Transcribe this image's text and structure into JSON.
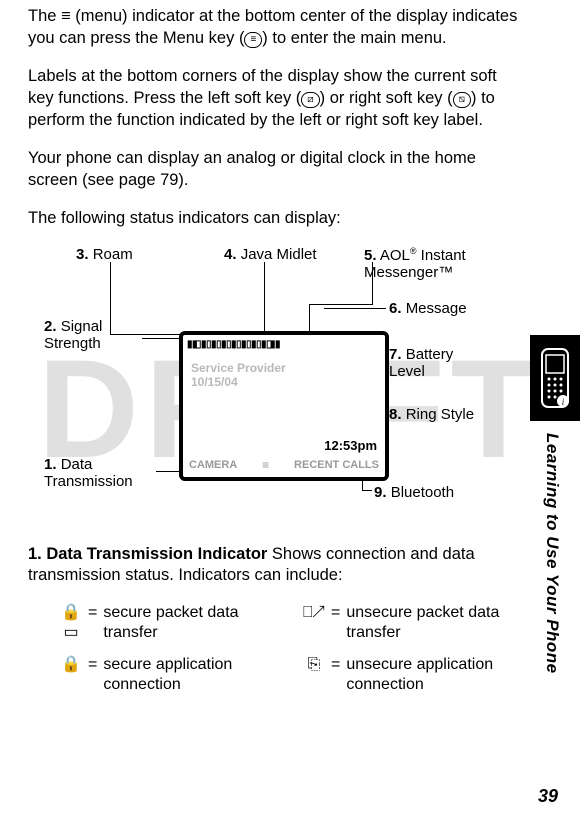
{
  "paragraphs": {
    "p1_a": "The ",
    "p1_menuicon": "≡",
    "p1_b": " (menu) indicator at the bottom center of the display indicates you can press the Menu key (",
    "p1_keyicon": "≡",
    "p1_c": ") to enter the main menu.",
    "p2_a": "Labels at the bottom corners of the display show the current soft key functions. Press the left soft key (",
    "p2_left": "⧄",
    "p2_b": ") or right soft key (",
    "p2_right": "⧅",
    "p2_c": ") to perform the function indicated by the left or right soft key label.",
    "p3": "Your phone can display an analog or digital clock in the home screen (see page 79).",
    "p4": "The following status indicators can display:"
  },
  "callouts": {
    "c1_num": "1.",
    "c1_label": "Data Transmission",
    "c2_num": "2.",
    "c2_label": "Signal Strength",
    "c3_num": "3.",
    "c3_label": "Roam",
    "c4_num": "4.",
    "c4_label": "Java Midlet",
    "c5_num": "5.",
    "c5_label_a": "AOL",
    "c5_reg": "®",
    "c5_label_b": " Instant Messenger™",
    "c6_num": "6.",
    "c6_label": "Message",
    "c7_num": "7.",
    "c7_label": "Battery Level",
    "c8_num": "8.",
    "c8_label": "Ring Style",
    "c9_num": "9.",
    "c9_label": "Bluetooth"
  },
  "screen": {
    "statusbar": "▮◧▮▯▮▯▮▯▮▯▮▯▮▯▮◨▮",
    "provider": "Service Provider",
    "date": "10/15/04",
    "clock": "12:53pm",
    "soft_left": "CAMERA",
    "soft_mid": "≡",
    "soft_right": "RECENT CALLS"
  },
  "section": {
    "heading": "1. Data Transmission Indicator",
    "body": " Shows connection and data transmission status. Indicators can include:"
  },
  "defs": {
    "a_icon": "🔒▭",
    "a_text": "secure packet data transfer",
    "b_icon": "⎕↗",
    "b_text": "unsecure packet data transfer",
    "c_icon": "🔒",
    "c_text": "secure application connection",
    "d_icon": "⎘",
    "d_text": "unsecure application connection",
    "eq": "="
  },
  "side": {
    "text": "Learning to Use Your Phone"
  },
  "page_number": "39"
}
